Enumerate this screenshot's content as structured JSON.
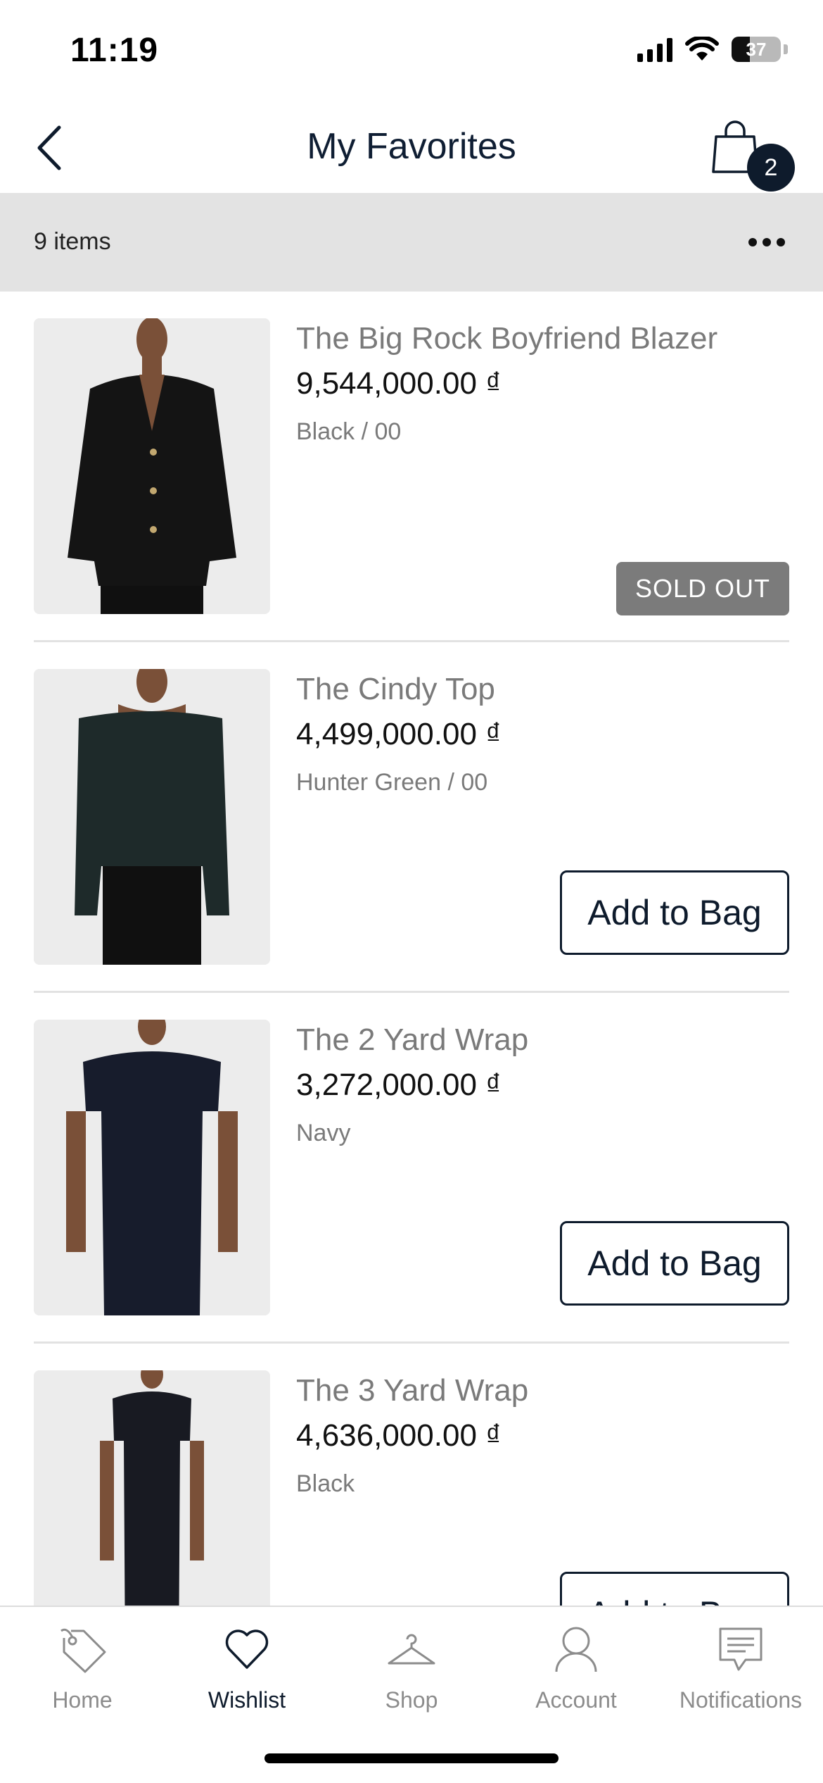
{
  "status_bar": {
    "time": "11:19",
    "battery": "37",
    "battery_level": 0.37
  },
  "header": {
    "title": "My Favorites",
    "bag_count": "2"
  },
  "toolbar": {
    "items_count": "9 items"
  },
  "items": [
    {
      "name": "The Big Rock Boyfriend Blazer",
      "price": "9,544,000.00 ₫",
      "variant": "Black / 00",
      "action": "SOLD OUT",
      "garment_color": "#141414"
    },
    {
      "name": "The Cindy Top",
      "price": "4,499,000.00 ₫",
      "variant": "Hunter Green / 00",
      "action": "Add to Bag",
      "garment_color": "#1e2a2a"
    },
    {
      "name": "The 2 Yard Wrap",
      "price": "3,272,000.00 ₫",
      "variant": "Navy",
      "action": "Add to Bag",
      "garment_color": "#171c2c"
    },
    {
      "name": "The 3 Yard Wrap",
      "price": "4,636,000.00 ₫",
      "variant": "Black",
      "action": "Add to Bag",
      "garment_color": "#181a22"
    }
  ],
  "tabs": [
    {
      "label": "Home",
      "icon": "tag-icon",
      "active": false
    },
    {
      "label": "Wishlist",
      "icon": "heart-icon",
      "active": true
    },
    {
      "label": "Shop",
      "icon": "hanger-icon",
      "active": false
    },
    {
      "label": "Account",
      "icon": "person-icon",
      "active": false
    },
    {
      "label": "Notifications",
      "icon": "message-icon",
      "active": false
    }
  ],
  "colors": {
    "accent": "#0e1b2c",
    "sold_out_bg": "#7b7b7b",
    "header_strip": "#e3e3e3"
  }
}
